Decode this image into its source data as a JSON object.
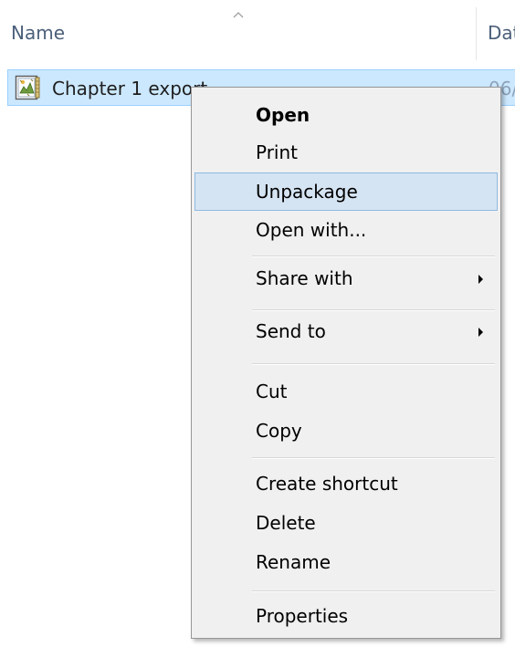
{
  "columns": {
    "name_label": "Name",
    "date_label": "Dat"
  },
  "file": {
    "name": "Chapter 1 export",
    "date": "06/",
    "icon": "package-file-icon"
  },
  "context_menu": {
    "items": [
      {
        "label": "Open",
        "bold": true
      },
      {
        "label": "Print"
      },
      {
        "label": "Unpackage",
        "highlighted": true
      },
      {
        "label": "Open with..."
      },
      {
        "label": "Share with",
        "submenu": true
      },
      {
        "label": "Send to",
        "submenu": true
      },
      {
        "label": "Cut"
      },
      {
        "label": "Copy"
      },
      {
        "label": "Create shortcut"
      },
      {
        "label": "Delete"
      },
      {
        "label": "Rename"
      },
      {
        "label": "Properties"
      }
    ]
  },
  "colors": {
    "selection_bg": "#cce8ff",
    "selection_border": "#99d1ff",
    "menu_bg": "#f0f0f0",
    "menu_hover_bg": "#d5e4f2",
    "menu_hover_border": "#8eb9e1",
    "header_text": "#4c607a"
  }
}
